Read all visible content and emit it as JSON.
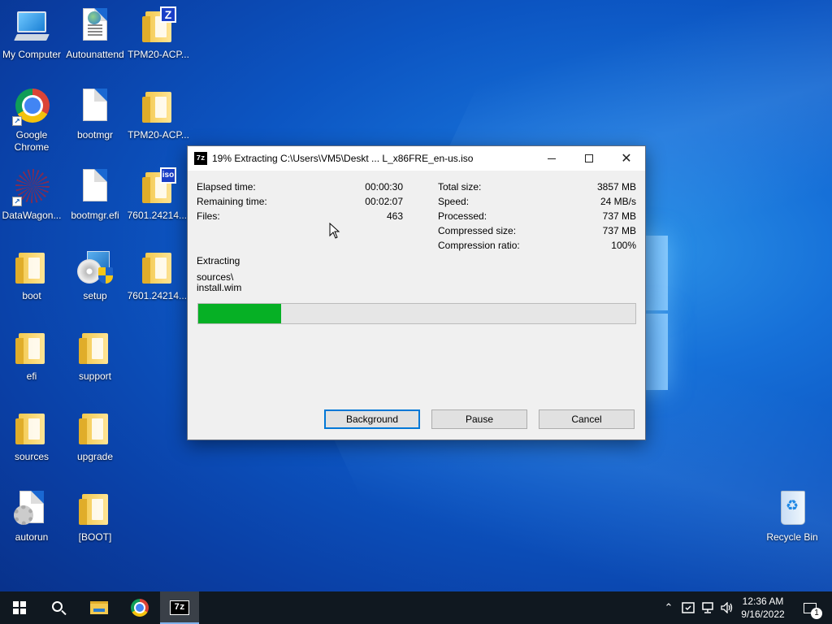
{
  "desktop": {
    "icons": [
      {
        "label": "My Computer",
        "icon": "computer-icon"
      },
      {
        "label": "Autounattend",
        "icon": "xml-file-icon"
      },
      {
        "label": "TPM20-ACP...",
        "icon": "zip-archive-icon"
      },
      {
        "label": "Google Chrome",
        "icon": "chrome-icon"
      },
      {
        "label": "bootmgr",
        "icon": "file-icon"
      },
      {
        "label": "TPM20-ACP...",
        "icon": "folder-icon"
      },
      {
        "label": "DataWagon...",
        "icon": "datawagon-icon"
      },
      {
        "label": "bootmgr.efi",
        "icon": "file-icon"
      },
      {
        "label": "7601.24214....",
        "icon": "iso-archive-icon"
      },
      {
        "label": "boot",
        "icon": "folder-icon"
      },
      {
        "label": "setup",
        "icon": "setup-icon"
      },
      {
        "label": "7601.24214....",
        "icon": "folder-icon"
      },
      {
        "label": "efi",
        "icon": "folder-icon"
      },
      {
        "label": "support",
        "icon": "folder-icon"
      },
      {
        "label": "sources",
        "icon": "folder-icon"
      },
      {
        "label": "upgrade",
        "icon": "folder-icon"
      },
      {
        "label": "autorun",
        "icon": "autorun-icon"
      },
      {
        "label": "[BOOT]",
        "icon": "folder-icon"
      },
      {
        "label": "Recycle Bin",
        "icon": "recycle-bin-icon"
      }
    ]
  },
  "dialog": {
    "app_icon_text": "7z",
    "title": "19% Extracting C:\\Users\\VM5\\Deskt ... L_x86FRE_en-us.iso",
    "left_stats": [
      {
        "label": "Elapsed time:",
        "value": "00:00:30"
      },
      {
        "label": "Remaining time:",
        "value": "00:02:07"
      },
      {
        "label": "Files:",
        "value": "463"
      }
    ],
    "right_stats": [
      {
        "label": "Total size:",
        "value": "3857 MB"
      },
      {
        "label": "Speed:",
        "value": "24 MB/s"
      },
      {
        "label": "Processed:",
        "value": "737 MB"
      },
      {
        "label": "Compressed size:",
        "value": "737 MB"
      },
      {
        "label": "Compression ratio:",
        "value": "100%"
      }
    ],
    "status_label": "Extracting",
    "current_path": "sources\\",
    "current_file": "install.wim",
    "progress_percent": 19,
    "progress_color": "#06b025",
    "buttons": {
      "background": "Background",
      "pause": "Pause",
      "cancel": "Cancel"
    }
  },
  "taskbar": {
    "clock_time": "12:36 AM",
    "clock_date": "9/16/2022",
    "notification_count": "1",
    "items": [
      "start-icon",
      "search-icon",
      "file-explorer-icon",
      "chrome-icon",
      "7zip-icon"
    ]
  }
}
